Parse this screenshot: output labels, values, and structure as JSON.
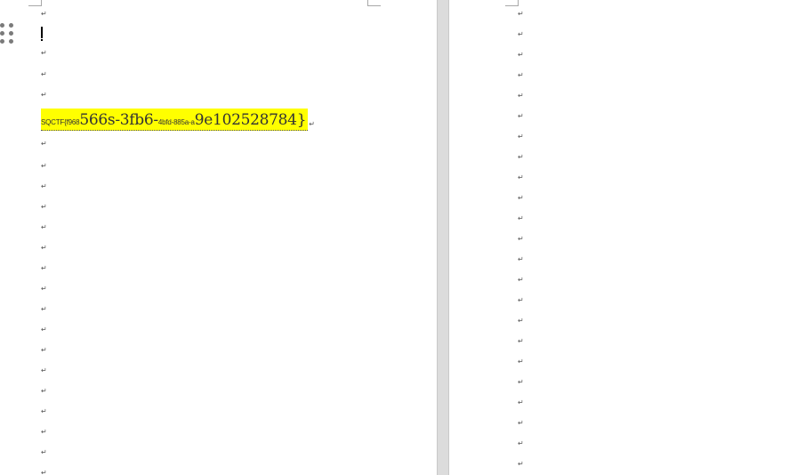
{
  "document": {
    "left_page": {
      "field_parts": [
        {
          "text": "SQCTF{f968",
          "style": "small"
        },
        {
          "text": "566s-3fb6-",
          "style": "big"
        },
        {
          "text": "4bfd-885a-a",
          "style": "small"
        },
        {
          "text": "9e102528784}",
          "style": "big"
        }
      ],
      "paragraph_mark": "↵",
      "trailing_mark": "↵",
      "highlight_color": "#ffff00"
    },
    "right_page": {
      "paragraph_mark": "↵"
    },
    "icons": {
      "drag_handle": "drag-handle-icon"
    }
  }
}
